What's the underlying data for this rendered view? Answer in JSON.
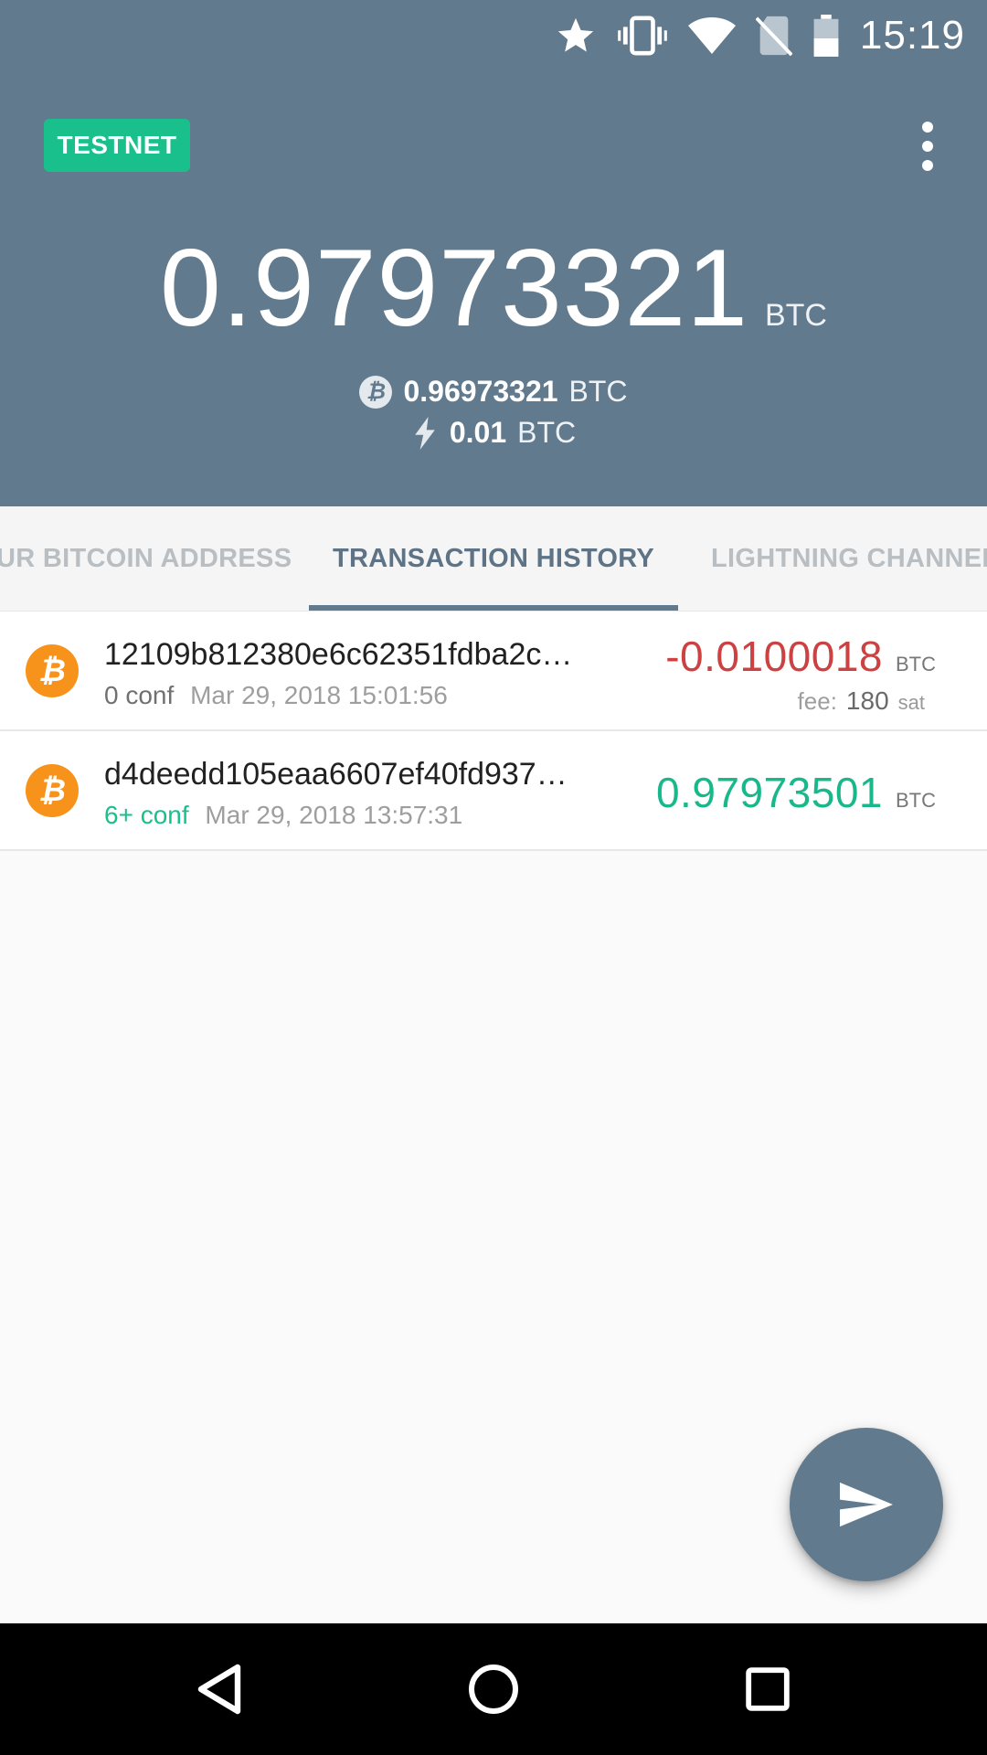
{
  "status_bar": {
    "time": "15:19",
    "icons": [
      "star-icon",
      "vibrate-icon",
      "wifi-icon",
      "no-sim-icon",
      "battery-icon"
    ]
  },
  "header": {
    "network_badge": "TESTNET",
    "total_balance": "0.97973321",
    "total_unit": "BTC",
    "onchain_balance": "0.96973321",
    "onchain_unit": "BTC",
    "lightning_balance": "0.01",
    "lightning_unit": "BTC",
    "colors": {
      "header_bg": "#627a8d",
      "badge": "#19c08c"
    }
  },
  "tabs": [
    {
      "label": "UR BITCOIN ADDRESS",
      "active": false
    },
    {
      "label": "TRANSACTION HISTORY",
      "active": true
    },
    {
      "label": "LIGHTNING CHANNELS",
      "active": false
    }
  ],
  "transactions": [
    {
      "hash": "12109b812380e6c62351fdba2c…",
      "conf": "0 conf",
      "date": "Mar 29, 2018 15:01:56",
      "amount": "-0.0100018",
      "unit": "BTC",
      "fee_label": "fee:",
      "fee_value": "180",
      "fee_unit": "sat",
      "color": "#cc4141"
    },
    {
      "hash": "d4deedd105eaa6607ef40fd937…",
      "conf": "6+ conf",
      "date": "Mar 29, 2018 13:57:31",
      "amount": "0.97973501",
      "unit": "BTC",
      "color": "#19b88a"
    }
  ],
  "fab": {
    "icon": "send-icon"
  },
  "nav": [
    "back-icon",
    "home-icon",
    "recents-icon"
  ]
}
